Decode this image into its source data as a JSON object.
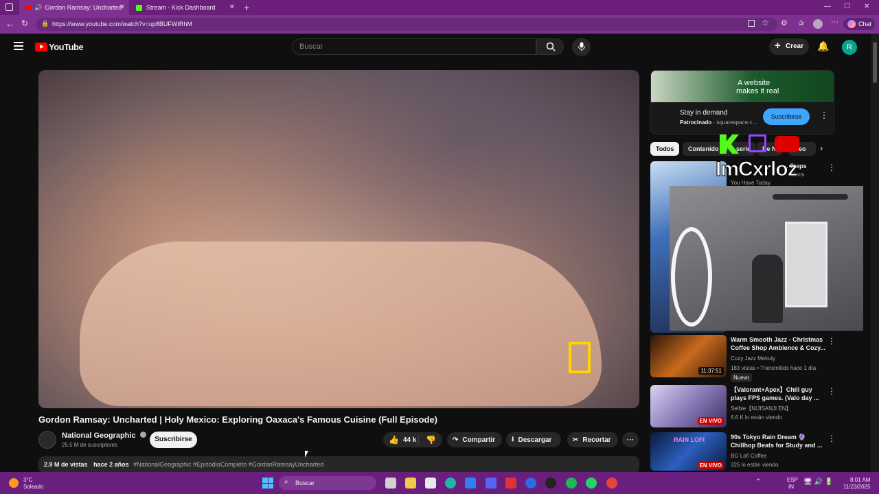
{
  "browser": {
    "tabs": [
      {
        "label": "Gordon Ramsay: Uncharted"
      },
      {
        "label": "Stream - Kick Dashboard"
      }
    ],
    "url": "https://www.youtube.com/watch?v=up8BUFWtRhM",
    "chat_label": "Chat"
  },
  "header": {
    "logo_text": "YouTube",
    "search_placeholder": "Buscar",
    "create_label": "Crear",
    "avatar_letter": "R"
  },
  "video": {
    "title": "Gordon Ramsay: Uncharted | Holy Mexico: Exploring Oaxaca's Famous Cuisine (Full Episode)",
    "channel": "National Geographic",
    "subscribers": "25.5 M de suscriptores",
    "subscribe_label": "Suscribirse",
    "likes": "44 k",
    "share_label": "Compartir",
    "download_label": "Descargar",
    "clip_label": "Recortar",
    "views": "2.9 M de vistas",
    "age": "hace 2 años",
    "hashtags": "#NationalGeographic #EpisodioCompleto #GordanRamsayUncharted"
  },
  "ad": {
    "banner_text_1": "A website",
    "banner_text_2": "makes it real",
    "title": "Stay in demand",
    "sponsored": "Patrocinado",
    "domain": "squarespace.c...",
    "subscribe_label": "Suscribirse"
  },
  "chips": [
    "Todos",
    "Contenido de la serie",
    "De N",
    "Geo"
  ],
  "overlay": {
    "name": "ImCxrloz"
  },
  "recommendations": [
    {
      "title": "... Steps",
      "line2": "...ions",
      "line3": "You Have Today."
    },
    {
      "title": "Warm Smooth Jazz - Christmas Coffee Shop Ambience & Cozy...",
      "channel": "Cozy Jazz Melody",
      "meta": "183 vistas • Transmitido hace 1 día",
      "badge": "Nuevo",
      "duration": "11:37:51"
    },
    {
      "title": "【Valorant+Apex】Chill guy plays FPS games. (Valo day ...",
      "channel": "Selbie【NIJISANJI EN】",
      "meta": "6.6 K lo están viendo",
      "live": "EN VIVO"
    },
    {
      "title": "90s Tokyo Rain Dream 🔮 Chillhop Beats for Study and ...",
      "channel": "BG Lofi Coffee",
      "meta": "325 lo están viendo",
      "live": "EN VIVO",
      "thumb_text": "RAIN LOFI"
    }
  ],
  "taskbar": {
    "temp": "3°C",
    "weather": "Soleado",
    "search": "Buscar",
    "lang1": "ESP",
    "lang2": "IN",
    "time": "8:01 AM",
    "date": "11/23/2025"
  },
  "colors": {
    "brand_red": "#ff0000",
    "browser_purple": "#7e3190",
    "kick_green": "#53fc18",
    "subscribe_blue": "#3ea6ff"
  }
}
